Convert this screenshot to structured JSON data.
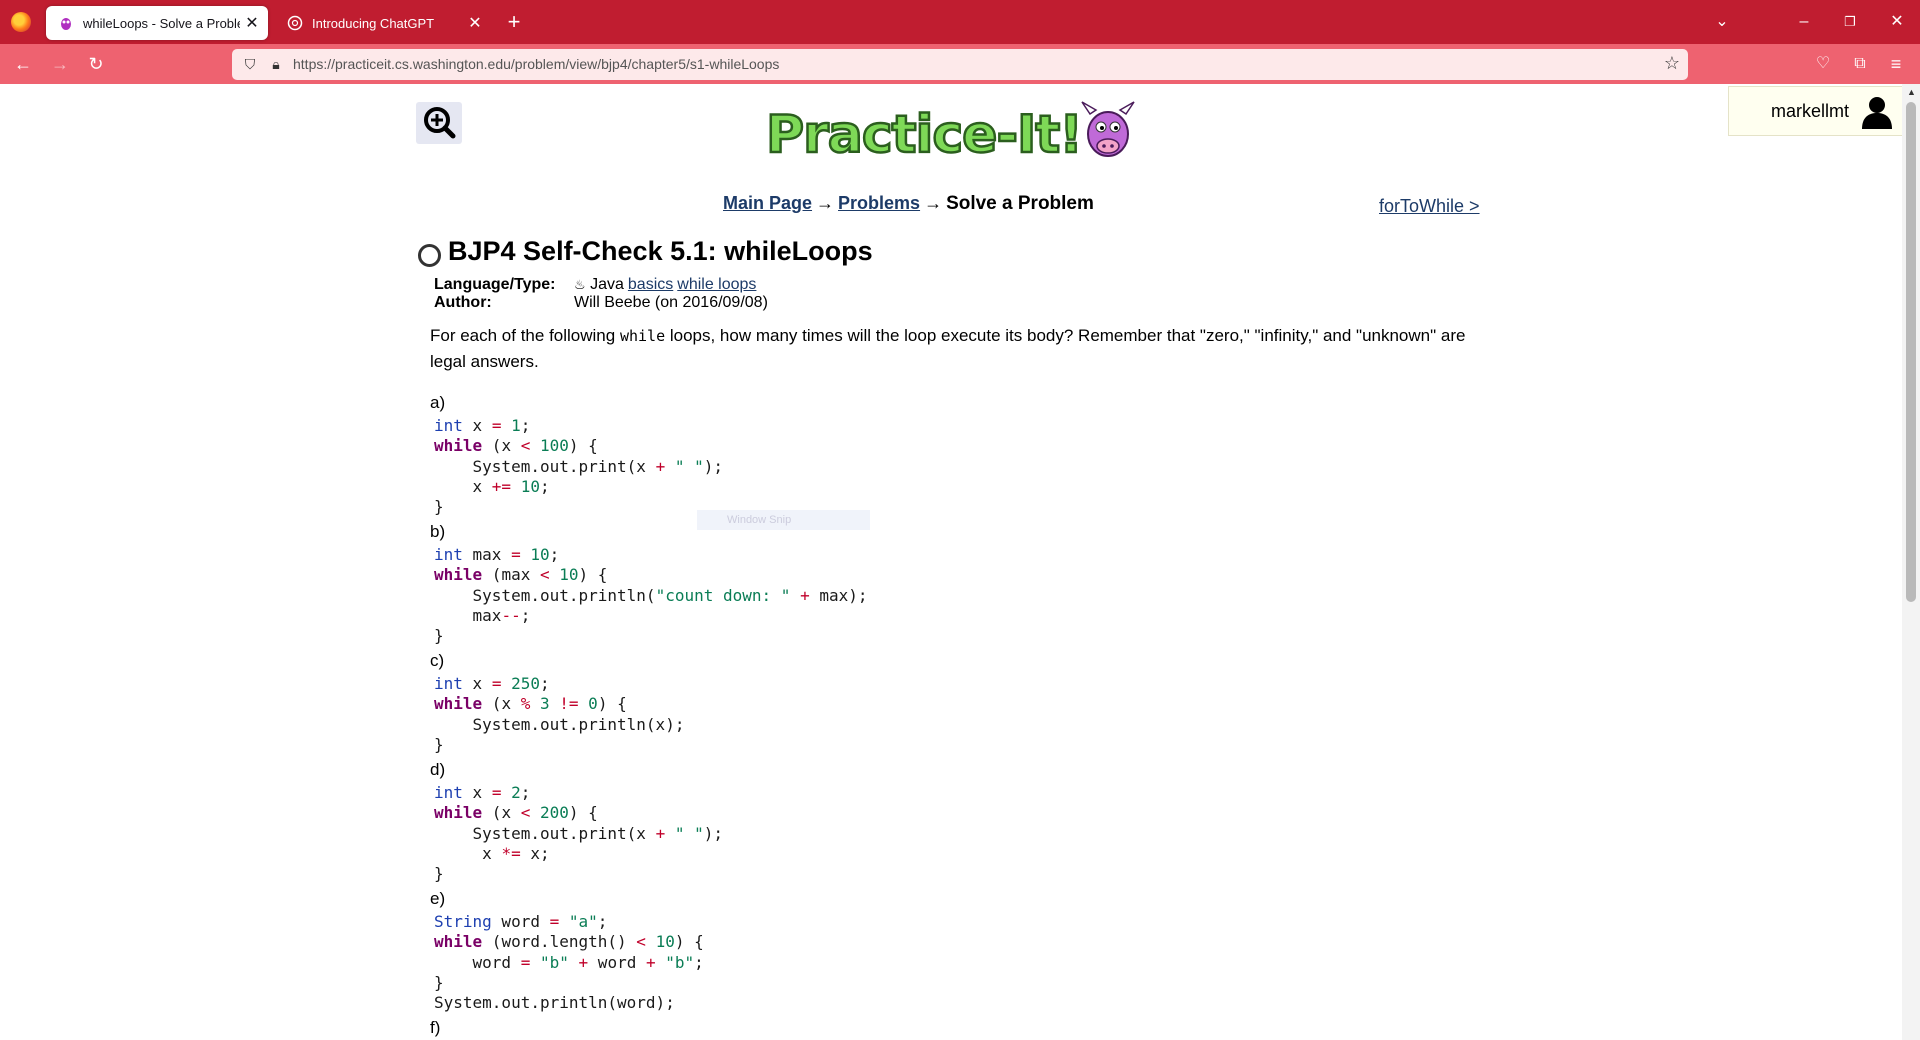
{
  "browser": {
    "tabs": [
      {
        "title": "whileLoops - Solve a Problem - ",
        "active": true,
        "icon": "practiceit-cow-icon"
      },
      {
        "title": "Introducing ChatGPT",
        "active": false,
        "icon": "openai-icon"
      }
    ],
    "url": "https://practiceit.cs.washington.edu/problem/view/bjp4/chapter5/s1-whileLoops",
    "accent_color": "#c01d30",
    "navbar_color": "#ee6270"
  },
  "user": {
    "name": "markellmt"
  },
  "breadcrumb": {
    "main_page": "Main Page",
    "problems": "Problems",
    "arrow": "→",
    "current": "Solve a Problem"
  },
  "next_link": "forToWhile >",
  "problem": {
    "title": "BJP4 Self-Check 5.1: whileLoops",
    "language_label": "Language/Type:",
    "language": "Java",
    "tags": [
      "basics",
      "while loops"
    ],
    "author_label": "Author:",
    "author": "Will Beebe (on 2016/09/08)",
    "desc_before": "For each of the following ",
    "desc_code": "while",
    "desc_after": " loops, how many times will the loop execute its body? Remember that \"zero,\" \"infinity,\" and \"unknown\" are legal answers."
  },
  "questions": [
    {
      "label": "a)",
      "code": "int x = 1;\nwhile (x < 100) {\n    System.out.print(x + \" \");\n    x += 10;\n}"
    },
    {
      "label": "b)",
      "code": "int max = 10;\nwhile (max < 10) {\n    System.out.println(\"count down: \" + max);\n    max--;\n}"
    },
    {
      "label": "c)",
      "code": "int x = 250;\nwhile (x % 3 != 0) {\n    System.out.println(x);\n}"
    },
    {
      "label": "d)",
      "code": "int x = 2;\nwhile (x < 200) {\n    System.out.print(x + \" \");\n     x *= x;\n}"
    },
    {
      "label": "e)",
      "code": "String word = \"a\";\nwhile (word.length() < 10) {\n    word = \"b\" + word + \"b\";\n}\nSystem.out.println(word);"
    },
    {
      "label": "f)",
      "code": ""
    }
  ],
  "overlay": {
    "window_snip": "Window Snip"
  }
}
